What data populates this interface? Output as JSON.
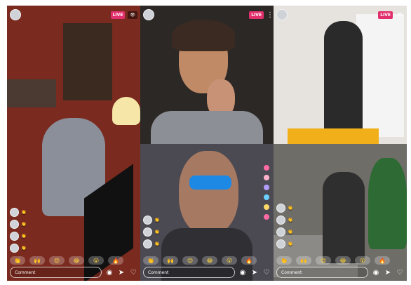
{
  "tiles": [
    {
      "live": "LIVE",
      "comment_placeholder": "Comment",
      "reactions": [
        "👏",
        "🙌",
        "😍",
        "😂",
        "😮",
        "🔥"
      ]
    },
    {
      "live": "LIVE",
      "comment_placeholder": "Comment",
      "reactions": [
        "👏",
        "🙌",
        "😍",
        "😂",
        "😮",
        "🔥"
      ]
    },
    {
      "live": "LIVE"
    },
    {
      "comment_placeholder": "Comment",
      "reactions": [
        "👏",
        "🙌",
        "😍",
        "😂",
        "😮",
        "🔥"
      ]
    },
    {
      "comment_placeholder": "Comment",
      "reactions": [
        "👏",
        "🙌",
        "😍",
        "😂",
        "😮",
        "🔥"
      ]
    }
  ],
  "icons": {
    "camera": "camera-icon",
    "send": "send-icon",
    "heart": "heart-icon",
    "more": "more-icon",
    "close": "close-icon"
  },
  "colors": {
    "live": "#e1306c"
  }
}
